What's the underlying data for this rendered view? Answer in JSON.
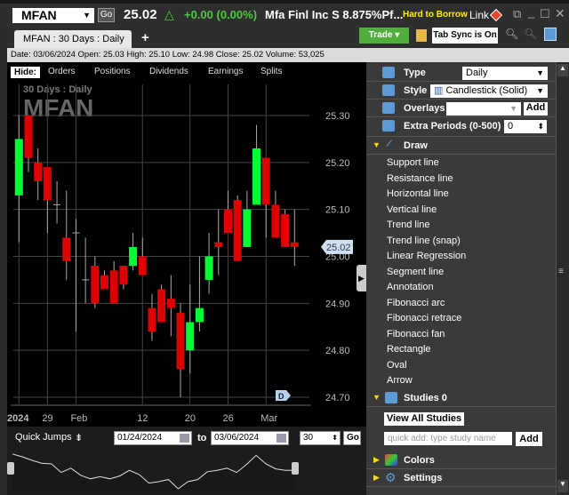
{
  "header": {
    "symbol": "MFAN",
    "go": "Go",
    "price": "25.02",
    "change": "+0.00 (0.00%)",
    "name": "Mfa Finl Inc S 8.875%Pf...",
    "badge": "Hard to Borrow",
    "link": "Link"
  },
  "tabs": {
    "active": "MFAN : 30  Days : Daily",
    "add": "+",
    "trade": "Trade ▾",
    "sync": "Tab Sync is On"
  },
  "info": "Date: 03/06/2024  Open: 25.03  High: 25.10  Low: 24.98  Close: 25.02  Volume: 53,025",
  "hide": {
    "label": "Hide:",
    "items": [
      "Orders",
      "Positions",
      "Dividends",
      "Earnings",
      "Splits"
    ]
  },
  "watermark": {
    "period": "30  Days : Daily",
    "symbol": "MFAN"
  },
  "chart_data": {
    "type": "candlestick",
    "ylim": [
      24.7,
      25.3
    ],
    "yticks": [
      "25.30",
      "25.20",
      "25.10",
      "25.00",
      "24.90",
      "24.80",
      "24.70"
    ],
    "last_price": "25.02",
    "xlabels": [
      {
        "i": 0,
        "t": "2024"
      },
      {
        "i": 3,
        "t": "29"
      },
      {
        "i": 6,
        "t": "Feb"
      },
      {
        "i": 13,
        "t": "12"
      },
      {
        "i": 18,
        "t": "20"
      },
      {
        "i": 22,
        "t": "26"
      },
      {
        "i": 26,
        "t": "Mar"
      }
    ],
    "marker": "D",
    "candles": [
      [
        25.13,
        25.3,
        25.03,
        25.25
      ],
      [
        25.3,
        25.3,
        25.18,
        25.21
      ],
      [
        25.2,
        25.23,
        25.12,
        25.16
      ],
      [
        25.19,
        25.19,
        25.05,
        25.12
      ],
      [
        25.11,
        25.16,
        25.07,
        25.11
      ],
      [
        25.04,
        25.14,
        24.95,
        24.99
      ],
      [
        25.05,
        25.08,
        24.84,
        25.05
      ],
      [
        24.95,
        25.04,
        24.9,
        24.95
      ],
      [
        24.98,
        25.0,
        24.89,
        24.9
      ],
      [
        24.96,
        24.97,
        24.93,
        24.93
      ],
      [
        24.97,
        24.99,
        24.9,
        24.9
      ],
      [
        24.98,
        24.98,
        24.93,
        24.94
      ],
      [
        24.98,
        25.05,
        24.97,
        25.02
      ],
      [
        25.0,
        25.04,
        24.96,
        24.96
      ],
      [
        24.89,
        24.92,
        24.82,
        24.84
      ],
      [
        24.93,
        24.94,
        24.86,
        24.86
      ],
      [
        24.91,
        24.96,
        24.83,
        24.89
      ],
      [
        24.88,
        24.9,
        24.7,
        24.76
      ],
      [
        24.8,
        24.94,
        24.75,
        24.86
      ],
      [
        24.86,
        25.0,
        24.84,
        24.89
      ],
      [
        24.95,
        25.05,
        24.92,
        25.0
      ],
      [
        25.03,
        25.1,
        24.96,
        25.02
      ],
      [
        25.1,
        25.14,
        25.05,
        25.05
      ],
      [
        25.12,
        25.13,
        24.99,
        24.99
      ],
      [
        25.02,
        25.14,
        25.02,
        25.1
      ],
      [
        25.11,
        25.28,
        25.11,
        25.23
      ],
      [
        25.21,
        25.21,
        25.04,
        25.11
      ],
      [
        25.11,
        25.14,
        25.04,
        25.04
      ],
      [
        25.09,
        25.1,
        25.02,
        25.02
      ],
      [
        25.03,
        25.1,
        24.98,
        25.02
      ]
    ]
  },
  "range": {
    "quick": "Quick Jumps",
    "from": "01/24/2024",
    "to_label": "to",
    "to": "03/06/2024",
    "periods": "30",
    "go": "Go"
  },
  "panel": {
    "type_label": "Type",
    "type_value": "Daily",
    "style_label": "Style",
    "style_value": "Candlestick (Solid)",
    "overlays_label": "Overlays",
    "overlays_add": "Add",
    "extra_label": "Extra Periods (0-500)",
    "extra_value": "0",
    "draw": "Draw",
    "draw_items": [
      "Support line",
      "Resistance line",
      "Horizontal line",
      "Vertical line",
      "Trend line",
      "Trend line (snap)",
      "Linear Regression",
      "Segment line",
      "Annotation",
      "Fibonacci arc",
      "Fibonacci retrace",
      "Fibonacci fan",
      "Rectangle",
      "Oval",
      "Arrow"
    ],
    "studies": "Studies 0",
    "view_all": "View All Studies",
    "quick_add_placeholder": "quick add: type study name",
    "add": "Add",
    "colors": "Colors",
    "settings": "Settings"
  },
  "colors": {
    "up": "#00ff33",
    "down": "#dd0000"
  }
}
